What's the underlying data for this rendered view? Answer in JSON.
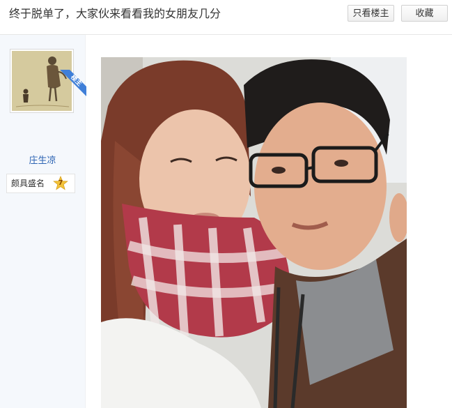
{
  "header": {
    "title": "终于脱单了，大家伙来看看我的女朋友几分",
    "only_op_label": "只看楼主",
    "collect_label": "收藏"
  },
  "author": {
    "badge": "楼主",
    "username": "庄生凉",
    "level_title": "颇具盛名",
    "level_num": "7"
  },
  "colors": {
    "link": "#2d64b3",
    "badge": "#3f7fd8",
    "level_star": "#f2c23a"
  }
}
